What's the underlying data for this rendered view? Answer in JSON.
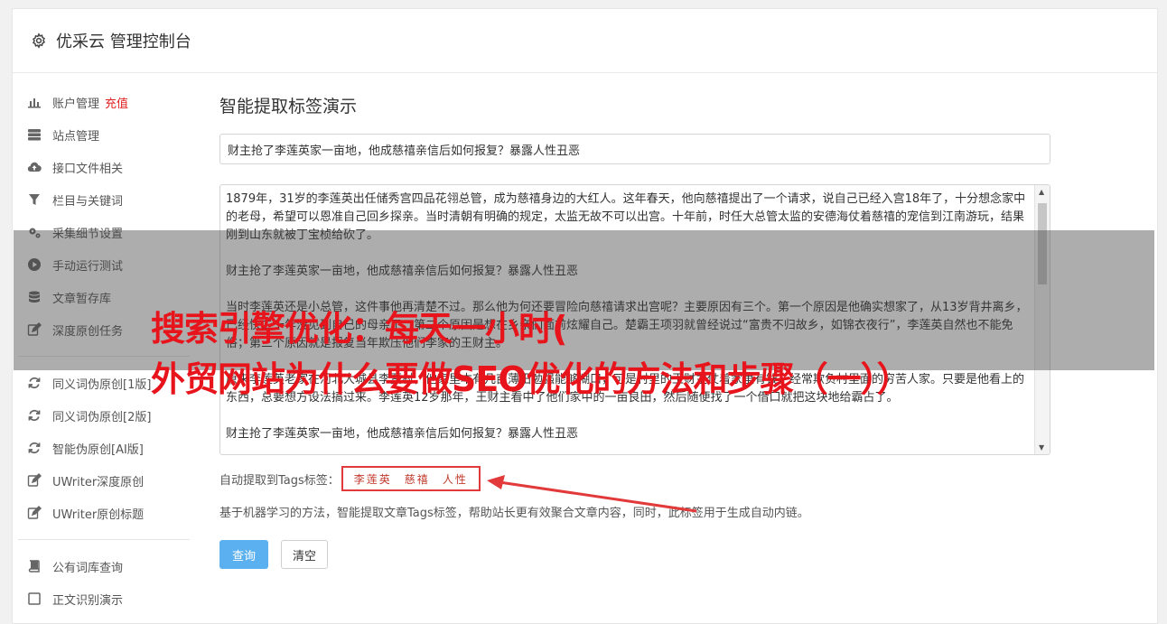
{
  "header": {
    "title": "优采云 管理控制台",
    "icon": "gear-icon"
  },
  "sidebar": {
    "items": [
      {
        "label": "账户管理",
        "badge": "充值",
        "icon": "bar-chart-icon"
      },
      {
        "label": "站点管理",
        "icon": "server-icon"
      },
      {
        "label": "接口文件相关",
        "icon": "cloud-upload-icon"
      },
      {
        "label": "栏目与关键词",
        "icon": "filter-icon"
      },
      {
        "label": "采集细节设置",
        "icon": "cogs-icon"
      },
      {
        "label": "手动运行测试",
        "icon": "play-circle-icon"
      },
      {
        "label": "文章暂存库",
        "icon": "database-icon"
      },
      {
        "label": "深度原创任务",
        "icon": "edit-icon"
      }
    ],
    "items2": [
      {
        "label": "同义词伪原创[1版]",
        "icon": "refresh-icon"
      },
      {
        "label": "同义词伪原创[2版]",
        "icon": "refresh-icon"
      },
      {
        "label": "智能伪原创[AI版]",
        "icon": "refresh-icon"
      },
      {
        "label": "UWriter深度原创",
        "icon": "edit-icon"
      },
      {
        "label": "UWriter原创标题",
        "icon": "edit-icon"
      }
    ],
    "items3": [
      {
        "label": "公有词库查询",
        "icon": "book-icon"
      },
      {
        "label": "正文识别演示",
        "icon": "square-icon"
      }
    ]
  },
  "main": {
    "title": "智能提取标签演示",
    "title_input_value": "财主抢了李莲英家一亩地，他成慈禧亲信后如何报复？暴露人性丑恶",
    "content_paragraphs": [
      "1879年，31岁的李莲英出任储秀宫四品花翎总管，成为慈禧身边的大红人。这年春天，他向慈禧提出了一个请求，说自己已经入宫18年了，十分想念家中的老母，希望可以恩准自己回乡探亲。当时清朝有明确的规定，太监无故不可以出宫。十年前，时任大总管太监的安德海仗着慈禧的宠信到江南游玩，结果刚到山东就被丁宝桢给砍了。",
      "财主抢了李莲英家一亩地，他成慈禧亲信后如何报复？暴露人性丑恶",
      "当时李莲英还是小总管，这件事他再清楚不过。那么他为何还要冒险向慈禧请求出宫呢？主要原因有三个。第一个原因是他确实想家了，从13岁背井离乡，已经快二十年没见到自己的母亲了；第二个原因是想在乡亲们面前炫耀自己。楚霸王项羽就曾经说过“富贵不归故乡，如锦衣夜行”，李莲英自然也不能免俗；第三个原因就是报复当年欺压他们李家的王财主。",
      "原来李莲英老家在河北大城县李贾村，他家里本有几亩薄田勉强能够糊口，可是村里的王财主仗着家里有钱，经常欺负村里面的穷苦人家。只要是他看上的东西，总要想方设法搞过来。李莲英12岁那年，王财主看中了他们家中的一亩良田，然后随便找了一个借口就把这块地给霸占了。",
      "财主抢了李莲英家一亩地，他成慈禧亲信后如何报复？暴露人性丑恶"
    ],
    "tags_label": "自动提取到Tags标签：",
    "tags": [
      "李莲英",
      "慈禧",
      "人性"
    ],
    "description": "基于机器学习的方法，智能提取文章Tags标签，帮助站长更有效聚合文章内容，同时，此标签用于生成自动内链。",
    "query_button": "查询",
    "clear_button": "清空"
  },
  "overlay": {
    "line1": "搜索引擎优化：每天一小时(",
    "line2": "外贸网站为什么要做SEO优化的方法和步骤（一））"
  },
  "colors": {
    "accent": "#5bb0ef",
    "highlight": "#e23a3a",
    "overlay_text": "#e8141c"
  }
}
